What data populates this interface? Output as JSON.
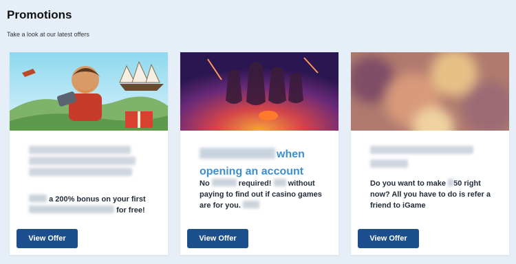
{
  "page": {
    "title": "Promotions",
    "subtitle": "Take a look at our latest offers"
  },
  "cards": [
    {
      "image": "slot-character-banner",
      "heading_visible": "",
      "desc_visible": [
        "a 200% bonus on your first",
        "for free!"
      ],
      "button_label": "View Offer"
    },
    {
      "image": "casino-heroes-banner",
      "heading_visible": [
        "when",
        "opening an account"
      ],
      "desc_visible": [
        "No",
        "required!",
        "without paying to find out if casino games are for you."
      ],
      "button_label": "View Offer"
    },
    {
      "image": "blurred-banner",
      "heading_visible": "",
      "desc_visible": [
        "Do you want to make",
        "50 right now? All you have to do is refer a friend to iGame"
      ],
      "button_label": "View Offer"
    }
  ],
  "colors": {
    "page_bg": "#e6eef8",
    "heading_blue": "#3b8fd0",
    "button_blue": "#1c4f8d"
  }
}
